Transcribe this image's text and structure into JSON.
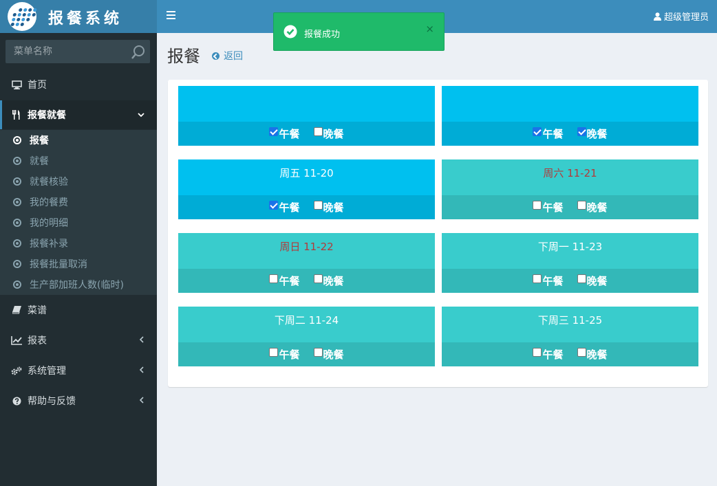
{
  "app": {
    "title": "报餐系统"
  },
  "search": {
    "placeholder": "菜单名称"
  },
  "header": {
    "user": "超级管理员"
  },
  "toast": {
    "message": "报餐成功",
    "close": "×"
  },
  "page": {
    "title": "报餐",
    "back": "返回"
  },
  "nav": {
    "home": "首页",
    "meal_group": "报餐就餐",
    "recipes": "菜谱",
    "reports": "报表",
    "system": "系统管理",
    "help": "帮助与反馈"
  },
  "submenu": [
    "报餐",
    "就餐",
    "就餐核验",
    "我的餐费",
    "我的明细",
    "报餐补录",
    "报餐批量取消",
    "生产部加班人数(临时)"
  ],
  "cards": [
    {
      "label": "",
      "lunch": true,
      "dinner": false
    },
    {
      "label": "",
      "lunch": true,
      "dinner": true
    },
    {
      "label": "周五 11-20",
      "lunch": true,
      "dinner": false
    },
    {
      "label": "周六 11-21",
      "lunch": false,
      "dinner": false
    },
    {
      "label": "周日 11-22",
      "lunch": false,
      "dinner": false
    },
    {
      "label": "下周一 11-23",
      "lunch": false,
      "dinner": false
    },
    {
      "label": "下周二 11-24",
      "lunch": false,
      "dinner": false
    },
    {
      "label": "下周三 11-25",
      "lunch": false,
      "dinner": false
    }
  ],
  "labels": {
    "lunch": "午餐",
    "dinner": "晚餐"
  }
}
